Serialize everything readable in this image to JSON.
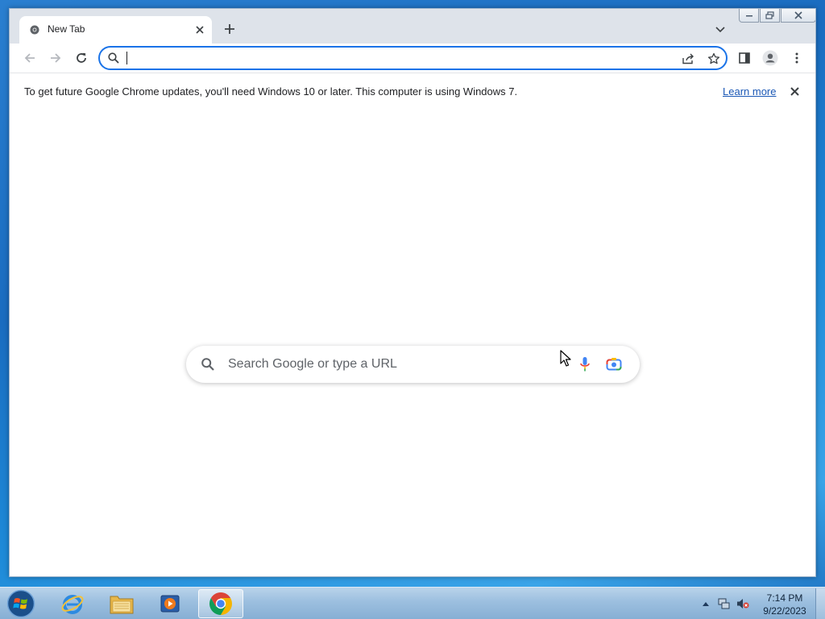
{
  "browser": {
    "tab": {
      "title": "New Tab"
    },
    "omnibox": {
      "value": "",
      "placeholder": ""
    },
    "infobar": {
      "message": "To get future Google Chrome updates, you'll need Windows 10 or later. This computer is using Windows 7.",
      "link": "Learn more"
    },
    "ntp": {
      "search_placeholder": "Search Google or type a URL"
    }
  },
  "taskbar": {
    "apps": [
      "internet-explorer",
      "windows-explorer",
      "media-player",
      "google-chrome"
    ],
    "active_app": "google-chrome",
    "clock": {
      "time": "7:14 PM",
      "date": "9/22/2023"
    }
  },
  "colors": {
    "accent": "#1a73e8",
    "tabstrip": "#dee3ea",
    "link": "#1a57b5"
  }
}
